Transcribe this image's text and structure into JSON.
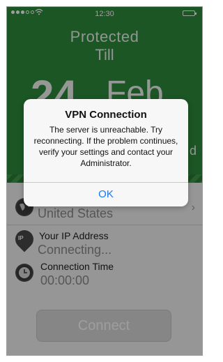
{
  "status_bar": {
    "time": "12:30",
    "wifi_icon": "wifi-icon",
    "battery_icon": "battery-icon"
  },
  "hero": {
    "line1": "Protected",
    "line2": "Till",
    "day": "24",
    "month": "Feb",
    "partial_text": "d"
  },
  "location": {
    "value": "United States",
    "icon": "globe-icon"
  },
  "ip": {
    "label": "Your IP Address",
    "value": "Connecting...",
    "icon": "ip-pin-icon"
  },
  "time": {
    "label": "Connection Time",
    "value": "00:00:00",
    "icon": "clock-icon"
  },
  "connect_button": "Connect",
  "alert": {
    "title": "VPN Connection",
    "message": "The server is unreachable. Try reconnecting. If the problem continues, verify your settings and contact your Administrator.",
    "ok_label": "OK"
  },
  "colors": {
    "hero_green": "#2e8b3c",
    "link_blue": "#1477f8"
  }
}
